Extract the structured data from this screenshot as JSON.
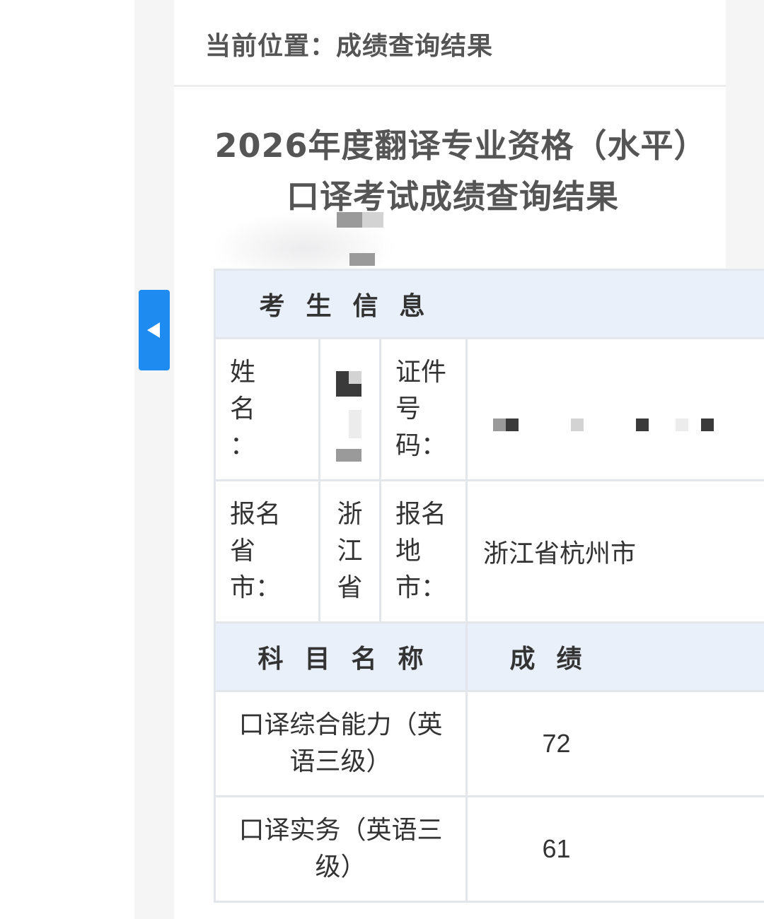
{
  "breadcrumb": {
    "text": "当前位置：成绩查询结果"
  },
  "page": {
    "title": "2026年度翻译专业资格（水平）口译考试成绩查询结果"
  },
  "sidebar_toggle": {
    "icon": "caret-left-icon",
    "color": "#1e8bf0"
  },
  "table": {
    "section_header": "考生信息",
    "name_label": "姓名：",
    "name_value": "",
    "id_label": "证件号码：",
    "id_value": "",
    "province_label": "报名省市：",
    "province_value": "浙江省",
    "city_label": "报名地市：",
    "city_value": "浙江省杭州市",
    "subject_header": "科目名称",
    "score_header": "成绩",
    "rows": [
      {
        "subject": "口译综合能力（英语三级）",
        "score": "72"
      },
      {
        "subject": "口译实务（英语三级）",
        "score": "61"
      }
    ]
  },
  "colors": {
    "header_bg": "#e9f0fa",
    "border": "#e3e6ea",
    "text": "#333333",
    "muted_text": "#555555"
  }
}
